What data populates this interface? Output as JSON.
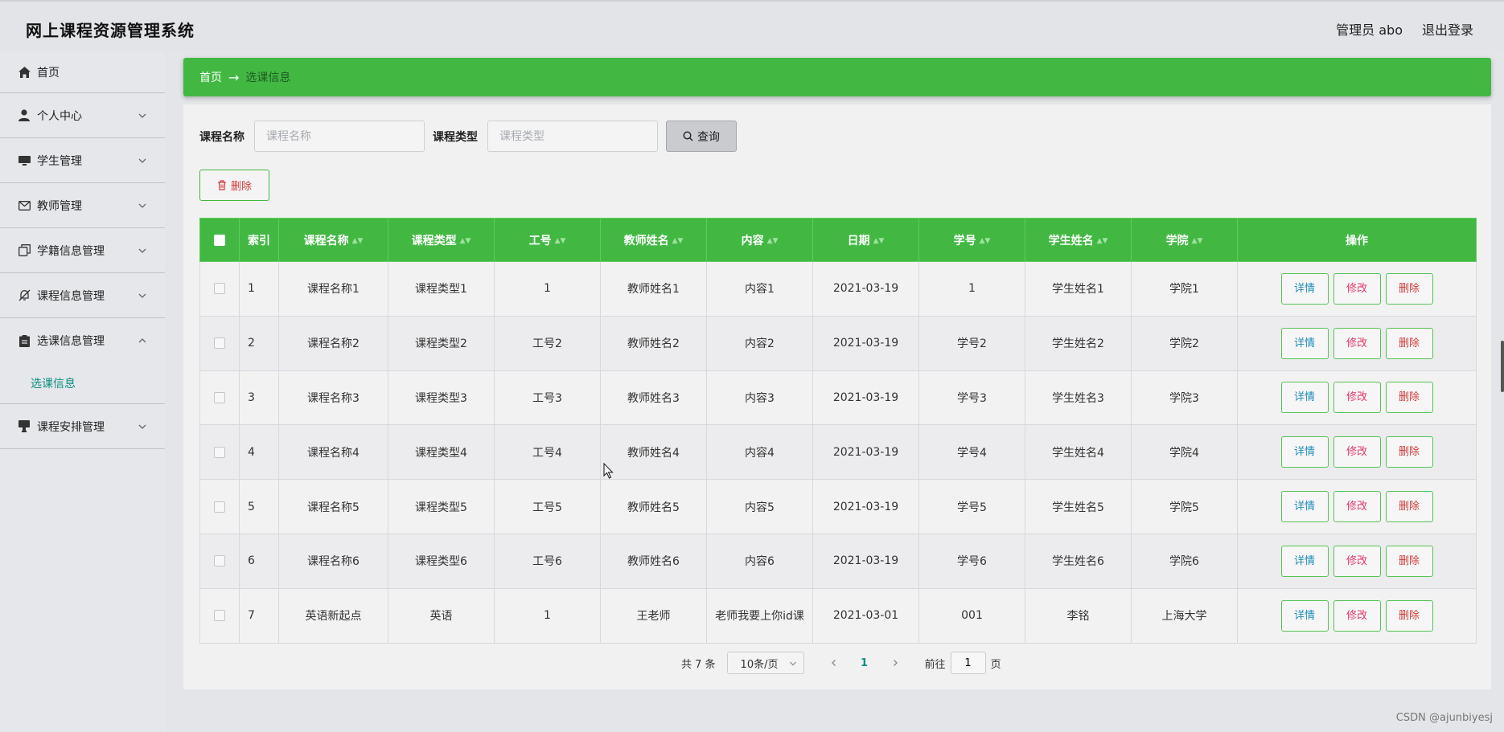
{
  "app": {
    "title": "网上课程资源管理系统"
  },
  "header": {
    "user_label": "管理员 abo",
    "logout_label": "退出登录"
  },
  "sidebar": {
    "items": [
      {
        "label": "首页",
        "icon": "home-icon"
      },
      {
        "label": "个人中心",
        "icon": "user-icon"
      },
      {
        "label": "学生管理",
        "icon": "monitor-icon"
      },
      {
        "label": "教师管理",
        "icon": "mail-icon"
      },
      {
        "label": "学籍信息管理",
        "icon": "copy-icon"
      },
      {
        "label": "课程信息管理",
        "icon": "bell-off-icon"
      },
      {
        "label": "选课信息管理",
        "icon": "clipboard-icon",
        "expanded": true,
        "children": [
          "选课信息"
        ]
      },
      {
        "label": "课程安排管理",
        "icon": "stamp-icon"
      }
    ]
  },
  "breadcrumb": {
    "home": "首页",
    "arrow": "→",
    "current": "选课信息"
  },
  "search": {
    "course_name_label": "课程名称",
    "course_name_placeholder": "课程名称",
    "course_type_label": "课程类型",
    "course_type_placeholder": "课程类型",
    "query_label": "查询"
  },
  "toolbar": {
    "delete_label": "删除"
  },
  "table": {
    "columns": [
      "索引",
      "课程名称",
      "课程类型",
      "工号",
      "教师姓名",
      "内容",
      "日期",
      "学号",
      "学生姓名",
      "学院",
      "操作"
    ],
    "rows": [
      [
        "1",
        "课程名称1",
        "课程类型1",
        "1",
        "教师姓名1",
        "内容1",
        "2021-03-19",
        "1",
        "学生姓名1",
        "学院1"
      ],
      [
        "2",
        "课程名称2",
        "课程类型2",
        "工号2",
        "教师姓名2",
        "内容2",
        "2021-03-19",
        "学号2",
        "学生姓名2",
        "学院2"
      ],
      [
        "3",
        "课程名称3",
        "课程类型3",
        "工号3",
        "教师姓名3",
        "内容3",
        "2021-03-19",
        "学号3",
        "学生姓名3",
        "学院3"
      ],
      [
        "4",
        "课程名称4",
        "课程类型4",
        "工号4",
        "教师姓名4",
        "内容4",
        "2021-03-19",
        "学号4",
        "学生姓名4",
        "学院4"
      ],
      [
        "5",
        "课程名称5",
        "课程类型5",
        "工号5",
        "教师姓名5",
        "内容5",
        "2021-03-19",
        "学号5",
        "学生姓名5",
        "学院5"
      ],
      [
        "6",
        "课程名称6",
        "课程类型6",
        "工号6",
        "教师姓名6",
        "内容6",
        "2021-03-19",
        "学号6",
        "学生姓名6",
        "学院6"
      ],
      [
        "7",
        "英语新起点",
        "英语",
        "1",
        "王老师",
        "老师我要上你id课",
        "2021-03-01",
        "001",
        "李铭",
        "上海大学"
      ]
    ],
    "actions": {
      "detail": "详情",
      "edit": "修改",
      "delete": "删除"
    }
  },
  "pagination": {
    "total": "共 7 条",
    "page_size": "10条/页",
    "current_page": "1",
    "goto_prefix": "前往",
    "goto_value": "1",
    "goto_suffix": "页"
  },
  "watermark": "CSDN @ajunbiyesj",
  "colors": {
    "accent": "#42b843",
    "sidebar_active": "#0a8f83"
  }
}
